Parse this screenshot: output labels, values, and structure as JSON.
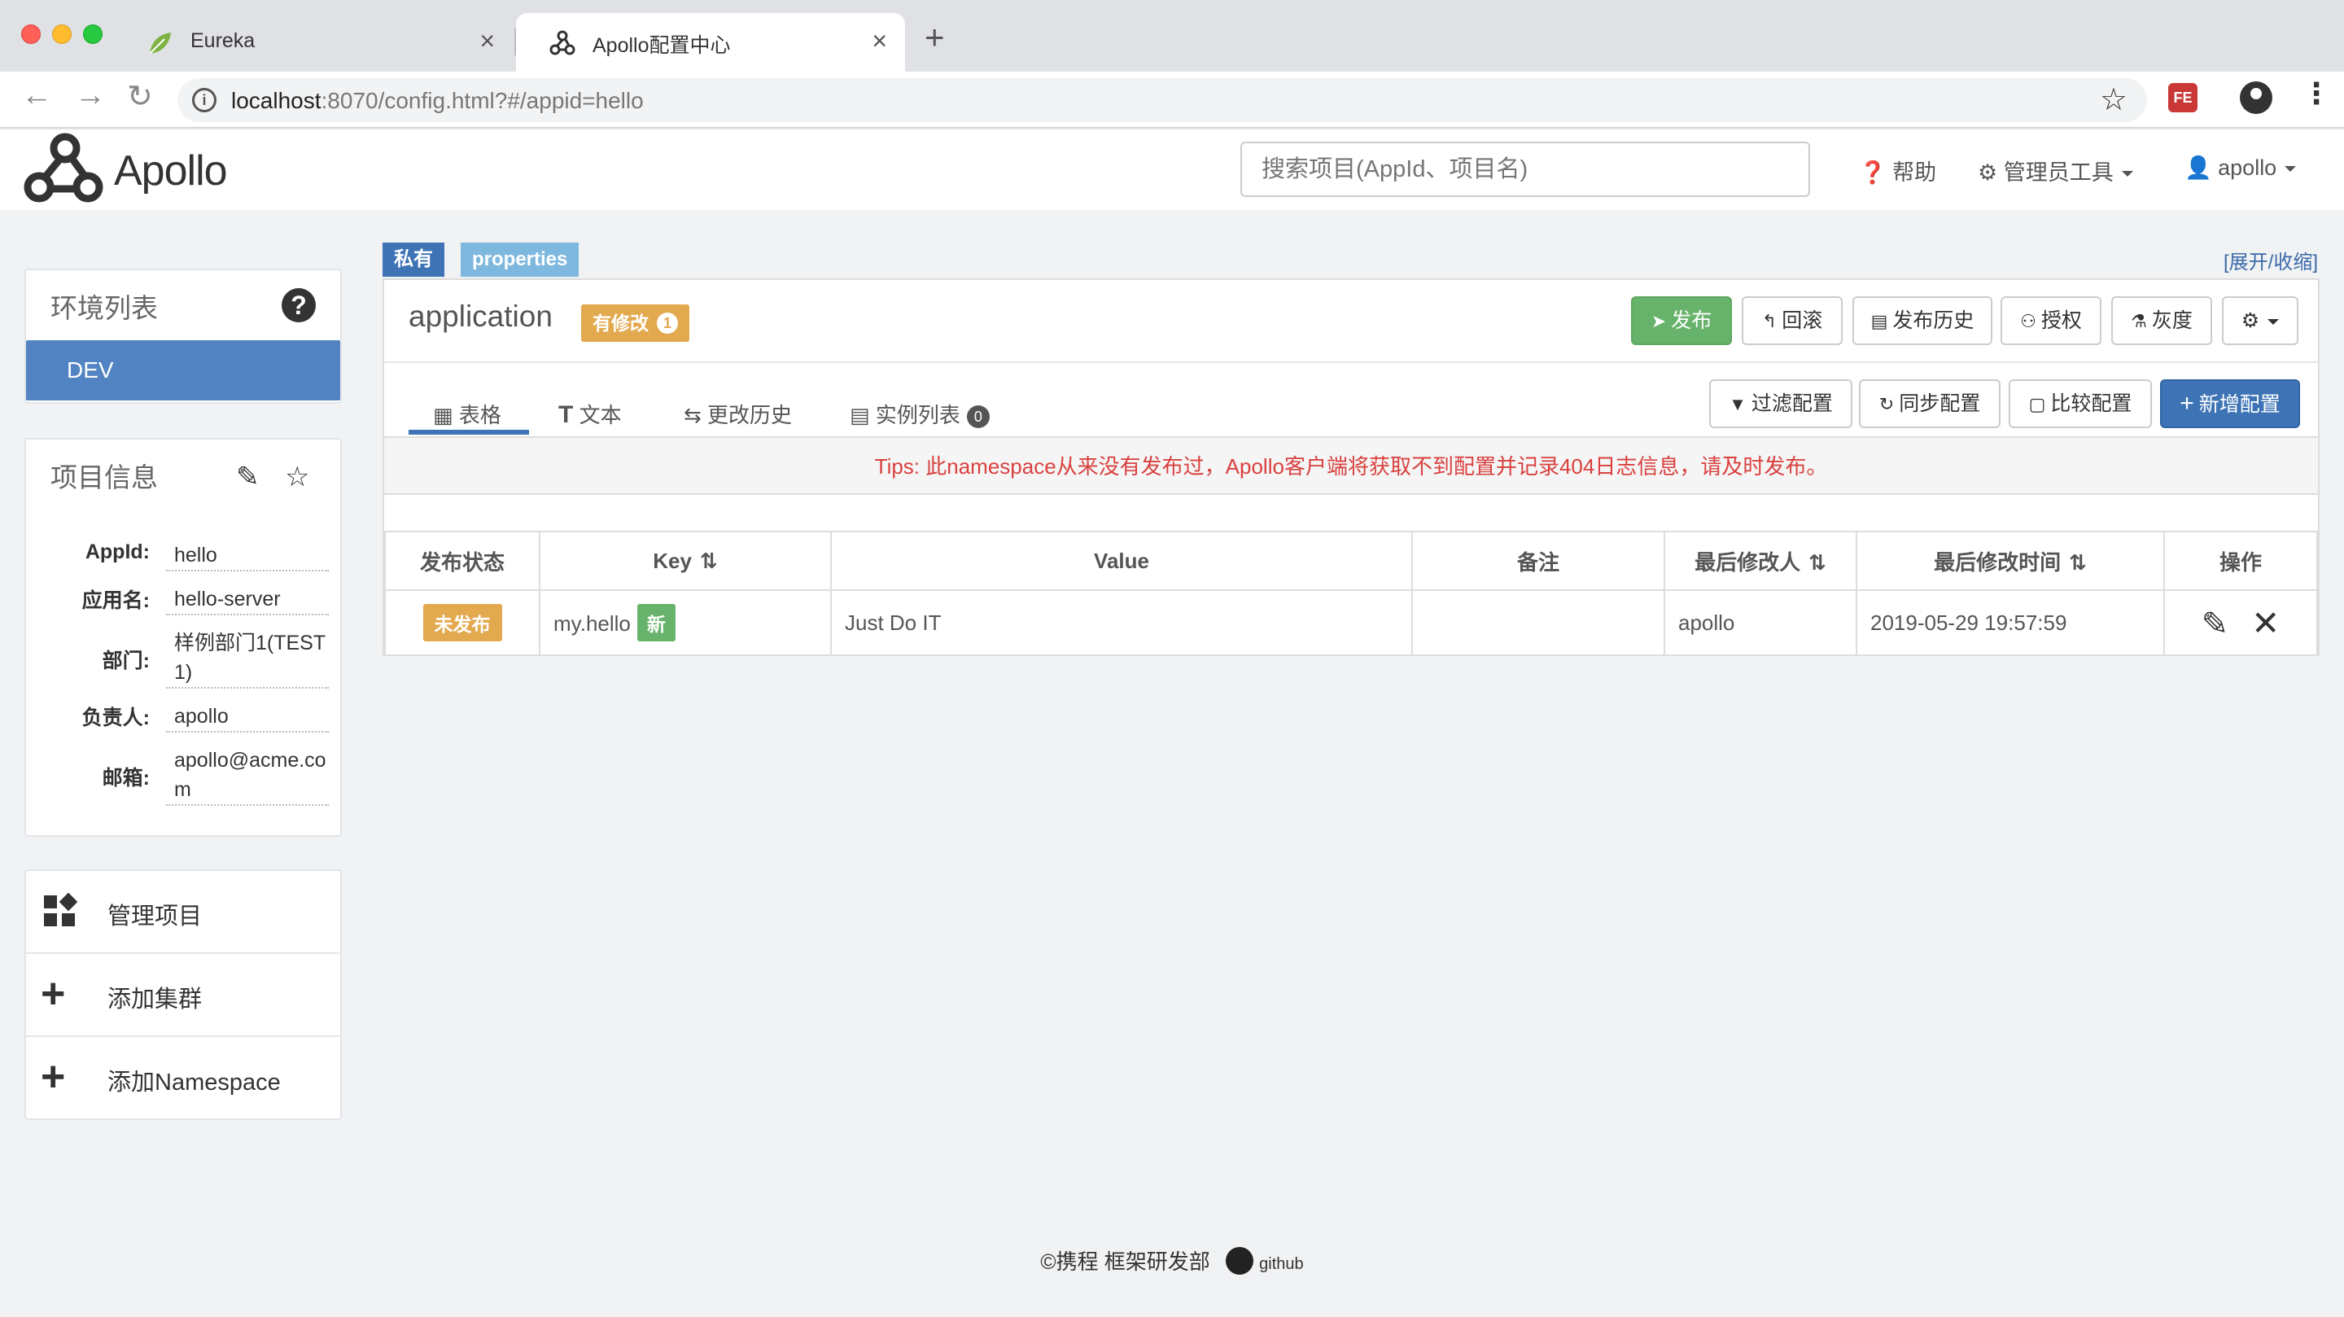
{
  "browser": {
    "tabs": [
      {
        "title": "Eureka",
        "icon": "leaf-icon"
      },
      {
        "title": "Apollo配置中心",
        "icon": "apollo-icon",
        "active": true
      }
    ],
    "url_host": "localhost",
    "url_path": ":8070/config.html?#/appid=hello",
    "extension_label": "FE"
  },
  "header": {
    "logo_text": "Apollo",
    "search_placeholder": "搜索项目(AppId、项目名)",
    "help_label": "帮助",
    "admin_tools_label": "管理员工具",
    "user_label": "apollo"
  },
  "sidebar": {
    "env_title": "环境列表",
    "env_selected": "DEV",
    "project_title": "项目信息",
    "project_info": [
      {
        "label": "AppId:",
        "value": "hello"
      },
      {
        "label": "应用名:",
        "value": "hello-server"
      },
      {
        "label": "部门:",
        "value": "样例部门1(TEST1)"
      },
      {
        "label": "负责人:",
        "value": "apollo"
      },
      {
        "label": "邮箱:",
        "value": "apollo@acme.com"
      }
    ],
    "menu": [
      {
        "label": "管理项目",
        "icon": "dashboard-icon"
      },
      {
        "label": "添加集群",
        "icon": "plus-icon"
      },
      {
        "label": "添加Namespace",
        "icon": "plus-icon"
      }
    ]
  },
  "namespace": {
    "scope_badge": "私有",
    "format_badge": "properties",
    "expand_toggle": "[展开/收缩]",
    "name": "application",
    "modified_label": "有修改",
    "modified_count": "1",
    "buttons": {
      "publish": "发布",
      "rollback": "回滚",
      "history": "发布历史",
      "grant": "授权",
      "gray": "灰度"
    },
    "tabs": {
      "table": "表格",
      "text": "文本",
      "history": "更改历史",
      "instances": "实例列表",
      "instances_count": "0"
    },
    "actions": {
      "filter": "过滤配置",
      "sync": "同步配置",
      "compare": "比较配置",
      "add": "新增配置"
    },
    "tips": "Tips: 此namespace从来没有发布过，Apollo客户端将获取不到配置并记录404日志信息，请及时发布。",
    "table": {
      "headers": [
        "发布状态",
        "Key",
        "Value",
        "备注",
        "最后修改人",
        "最后修改时间",
        "操作"
      ],
      "rows": [
        {
          "status": "未发布",
          "key": "my.hello",
          "key_tag": "新",
          "value": "Just Do IT",
          "comment": "",
          "modifier": "apollo",
          "modified_time": "2019-05-29 19:57:59"
        }
      ]
    }
  },
  "footer": {
    "text": "©携程 框架研发部",
    "github_label": "github"
  },
  "colors": {
    "primary": "#3e74b5",
    "success": "#68b36b",
    "warning": "#e3a94f",
    "danger": "#d9413f",
    "env_active": "#5283c2"
  }
}
